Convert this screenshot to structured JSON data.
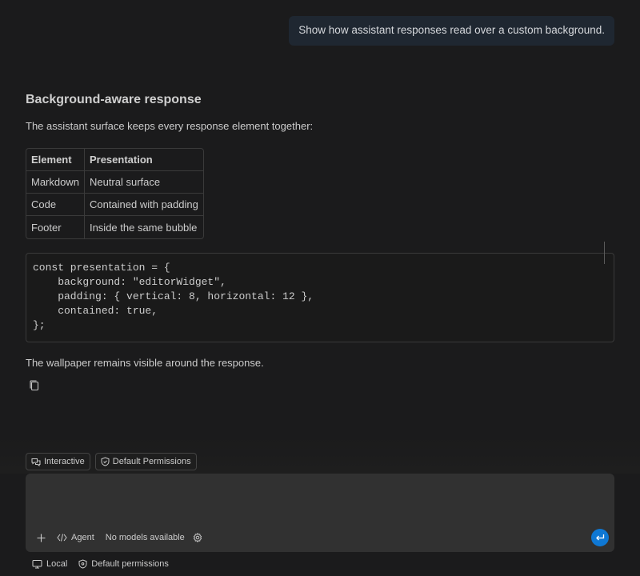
{
  "user_message": "Show how assistant responses read over a custom background.",
  "response": {
    "heading": "Background-aware response",
    "intro": "The assistant surface keeps every response element together:",
    "table": {
      "headers": [
        "Element",
        "Presentation"
      ],
      "rows": [
        [
          "Markdown",
          "Neutral surface"
        ],
        [
          "Code",
          "Contained with padding"
        ],
        [
          "Footer",
          "Inside the same bubble"
        ]
      ]
    },
    "code_lines": [
      "const presentation = {",
      "    background: \"editorWidget\",",
      "    padding: { vertical: 8, horizontal: 12 },",
      "    contained: true,",
      "};"
    ],
    "outro": "The wallpaper remains visible around the response."
  },
  "composer": {
    "chips": [
      {
        "label": "Interactive",
        "icon": "chat-bubbles-icon"
      },
      {
        "label": "Default Permissions",
        "icon": "shield-icon"
      }
    ],
    "input_placeholder": "",
    "toolbar": {
      "add_icon": "plus-icon",
      "mode_label": "Agent",
      "mode_icon": "agent-icon",
      "model_label": "No models available",
      "settings_icon": "gear-icon"
    },
    "send_icon": "enter-icon"
  },
  "status": {
    "location_label": "Local",
    "permissions_label": "Default permissions"
  },
  "colors": {
    "background": "#1b1b1c",
    "user_bubble": "#1f2731",
    "input_box": "#313131",
    "accent": "#0f78d4",
    "border": "#3a3a3a"
  }
}
